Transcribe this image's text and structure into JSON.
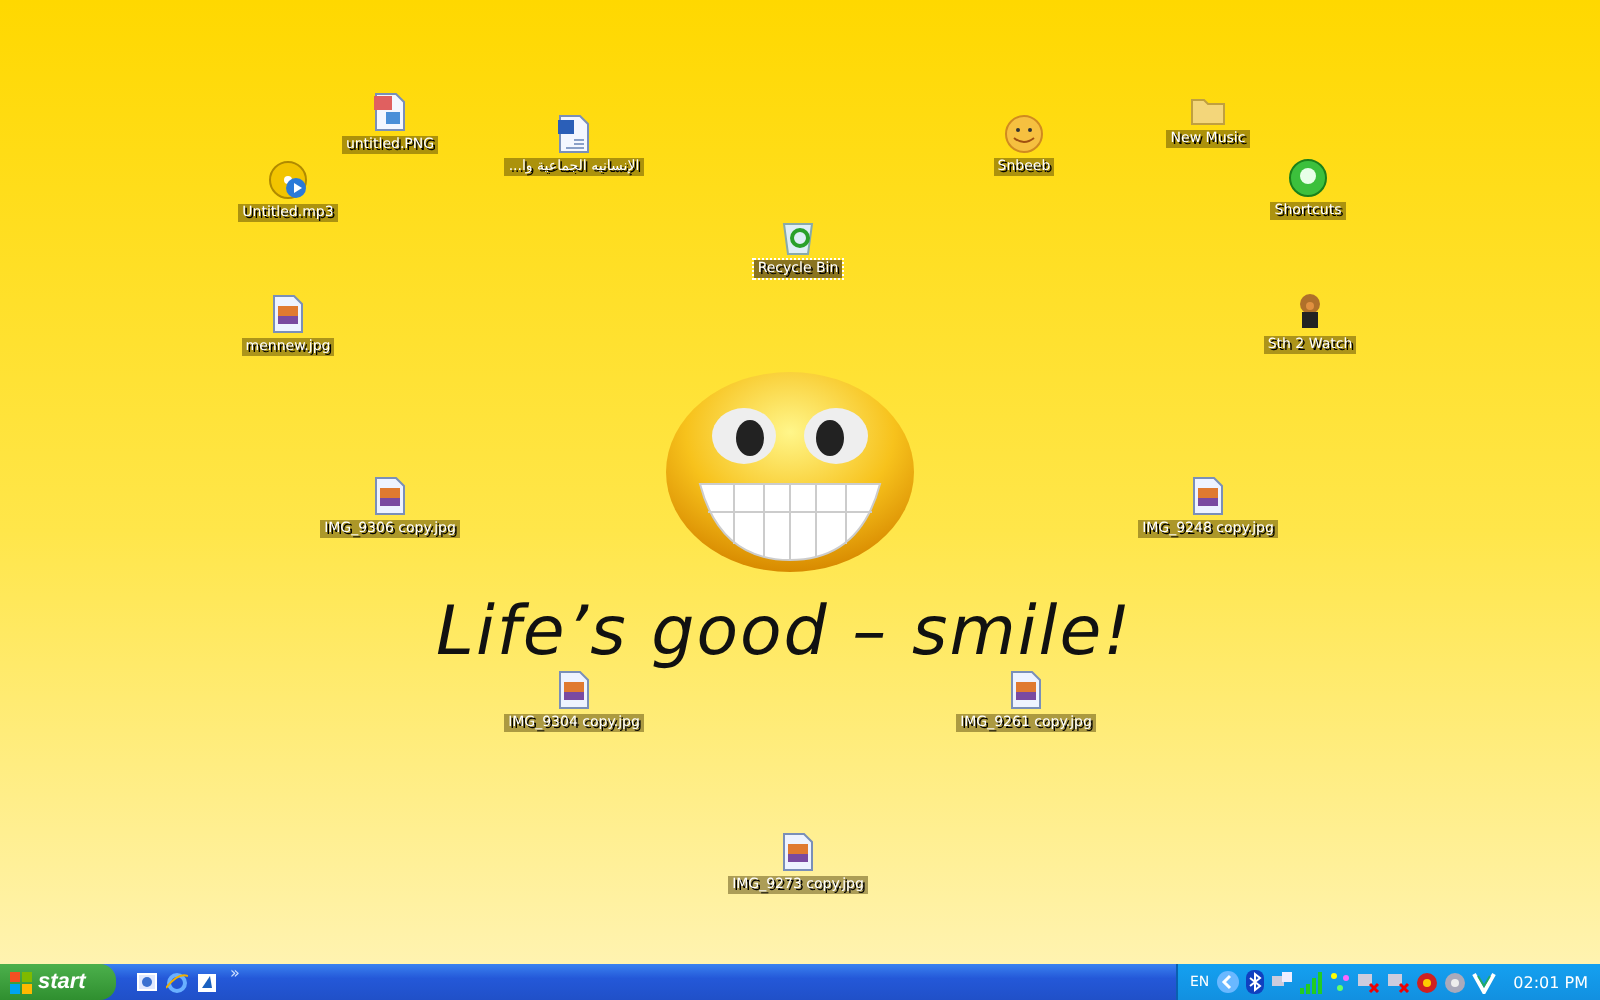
{
  "desktop": {
    "wallpaper_caption": "Life’s good – smile!",
    "icons": [
      {
        "kind": "image",
        "label": "untitled.PNG",
        "selected": false
      },
      {
        "kind": "audio",
        "label": "Untitled.mp3",
        "selected": false
      },
      {
        "kind": "document",
        "label": "الإنسانيه الجماعية وا...",
        "selected": false
      },
      {
        "kind": "recycle",
        "label": "Recycle Bin",
        "selected": true
      },
      {
        "kind": "smiley",
        "label": "Snbeeb",
        "selected": false
      },
      {
        "kind": "folder",
        "label": "New Music",
        "selected": false
      },
      {
        "kind": "shortcuts",
        "label": "Shortcuts",
        "selected": false
      },
      {
        "kind": "character",
        "label": "Sth 2 Watch",
        "selected": false
      },
      {
        "kind": "photo",
        "label": "mennew.jpg",
        "selected": false
      },
      {
        "kind": "photo",
        "label": "IMG_9306 copy.jpg",
        "selected": false
      },
      {
        "kind": "photo",
        "label": "IMG_9248 copy.jpg",
        "selected": false
      },
      {
        "kind": "photo",
        "label": "IMG_9304 copy.jpg",
        "selected": false
      },
      {
        "kind": "photo",
        "label": "IMG_9261 copy.jpg",
        "selected": false
      },
      {
        "kind": "photo",
        "label": "IMG_9273 copy.jpg",
        "selected": false
      }
    ]
  },
  "taskbar": {
    "start": "start",
    "quick_launch_more": "»",
    "language": "EN",
    "clock": "02:01 PM"
  }
}
